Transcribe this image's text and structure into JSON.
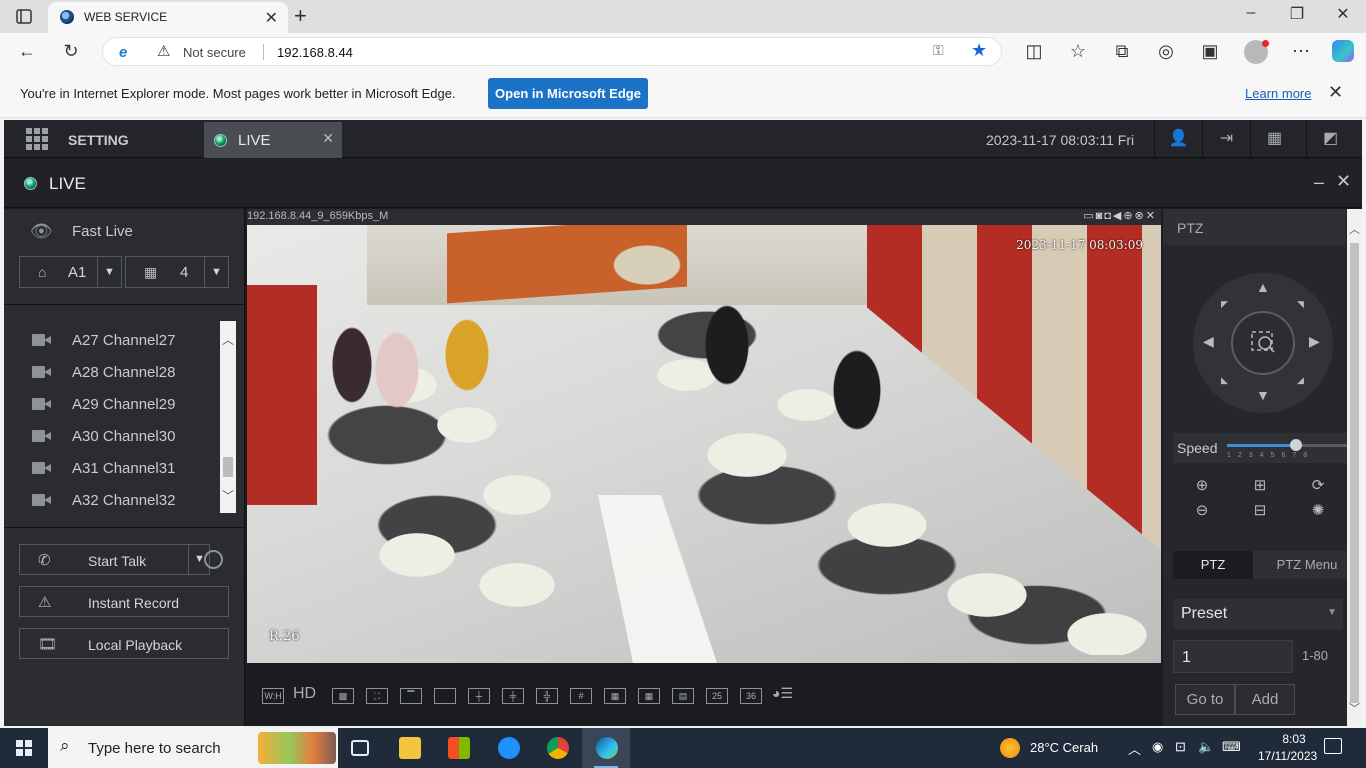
{
  "browser": {
    "tab_title": "WEB SERVICE",
    "url": "192.168.8.44",
    "security_label": "Not secure",
    "window_controls": [
      "–",
      "❐",
      "✕"
    ]
  },
  "ie_bar": {
    "message": "You're in Internet Explorer mode. Most pages work better in Microsoft Edge.",
    "open_button": "Open in Microsoft Edge",
    "learn_more": "Learn more"
  },
  "app": {
    "setting_label": "SETTING",
    "live_tab_label": "LIVE",
    "datetime": "2023-11-17 08:03:11 Fri",
    "live_title": "LIVE"
  },
  "left_panel": {
    "fast_live": "Fast Live",
    "channel_selector": "A1",
    "layout_selector": "4",
    "channels": [
      {
        "label": "A27 Channel27"
      },
      {
        "label": "A28 Channel28"
      },
      {
        "label": "A29 Channel29"
      },
      {
        "label": "A30 Channel30"
      },
      {
        "label": "A31 Channel31"
      },
      {
        "label": "A32 Channel32"
      }
    ],
    "start_talk": "Start Talk",
    "instant_record": "Instant Record",
    "local_playback": "Local Playback"
  },
  "video": {
    "stream_info": "192.168.8.44_9_659Kbps_M",
    "osd_timestamp": "2023-11-17 08:03:09",
    "room_label": "R.26"
  },
  "layout_bar": {
    "hd_label": "HD",
    "layout_25": "25",
    "layout_36": "36",
    "wh_label": "W:H"
  },
  "ptz": {
    "title": "PTZ",
    "speed_label": "Speed",
    "speed_value": 5,
    "speed_max": 8,
    "speed_ticks": "12345678",
    "tab_ptz": "PTZ",
    "tab_menu": "PTZ Menu",
    "preset_select": "Preset",
    "preset_value": "1",
    "preset_range": "1-80",
    "goto_button": "Go to",
    "add_button": "Add"
  },
  "taskbar": {
    "search_placeholder": "Type here to search",
    "weather": "28°C  Cerah",
    "time": "8:03",
    "date": "17/11/2023"
  }
}
